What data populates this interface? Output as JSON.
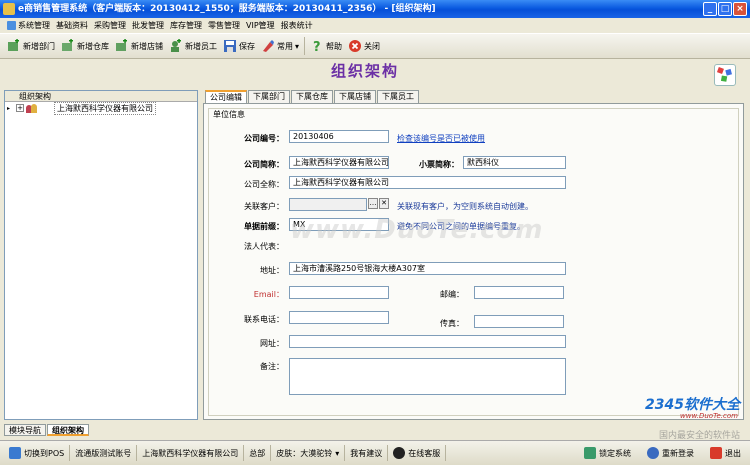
{
  "window": {
    "title": "e商销售管理系统（客户端版本：20130412_1550；服务端版本：20130411_2356） - [组织架构]",
    "controls": [
      "_",
      "□",
      "×"
    ]
  },
  "menu": [
    "系统管理",
    "基础资料",
    "采购管理",
    "批发管理",
    "库存管理",
    "零售管理",
    "VIP管理",
    "报表统计"
  ],
  "toolbar": {
    "buttons": [
      "新增部门",
      "新增仓库",
      "新增店铺",
      "新增员工",
      "保存",
      "常用",
      "帮助",
      "关闭"
    ]
  },
  "page": {
    "title": "组织架构"
  },
  "tree": {
    "header": "组织架构",
    "root": "上海默西科学仪器有限公司"
  },
  "tabs": [
    "公司编辑",
    "下属部门",
    "下属仓库",
    "下属店铺",
    "下属员工"
  ],
  "form": {
    "group_title": "单位信息",
    "company_code_label": "公司编号：",
    "company_code": "20130406",
    "check_code_link": "检查该编号是否已被使用",
    "short_name_label": "公司简称：",
    "short_name": "上海默西科学仪器有限公司",
    "ticket_name_label": "小票简称：",
    "ticket_name": "默西科仪",
    "full_name_label": "公司全称：",
    "full_name": "上海默西科学仪器有限公司",
    "customer_label": "关联客户：",
    "customer": "",
    "customer_hint": "关联现有客户，为空则系统自动创建。",
    "prefix_label": "单据前缀：",
    "prefix": "MX",
    "prefix_hint": "避免不同公司之间的单据编号重复。",
    "legal_rep_label": "法人代表：",
    "address_label": "地址：",
    "address": "上海市漕溪路250号银海大楼A307室",
    "email_label": "Email：",
    "email": "",
    "zip_label": "邮编：",
    "zip": "",
    "phone_label": "联系电话：",
    "phone": "",
    "fax_label": "传真：",
    "fax": "",
    "website_label": "网址：",
    "website": "",
    "remark_label": "备注：",
    "remark": ""
  },
  "watermark": "www.DuoTe.com",
  "bottom_tabs": [
    "模块导航",
    "组织架构"
  ],
  "status": {
    "switch_pos": "切换到POS",
    "account": "流通版测试账号",
    "company": "上海默西科学仪器有限公司",
    "dept": "总部",
    "skin": "皮肤：大漠驼铃",
    "feedback": "我有建议",
    "support": "在线客服",
    "lock": "锁定系统",
    "relogin": "重新登录",
    "exit": "退出"
  },
  "brand": {
    "name": "2345软件大全",
    "url": "www.DuoTe.com",
    "slogan": "国内最安全的软件站"
  },
  "colors": {
    "title_bar": "#0a5ae0",
    "page_title": "#6b2fa5",
    "hint": "#1a3a9a",
    "active_tab": "#f0a030"
  }
}
